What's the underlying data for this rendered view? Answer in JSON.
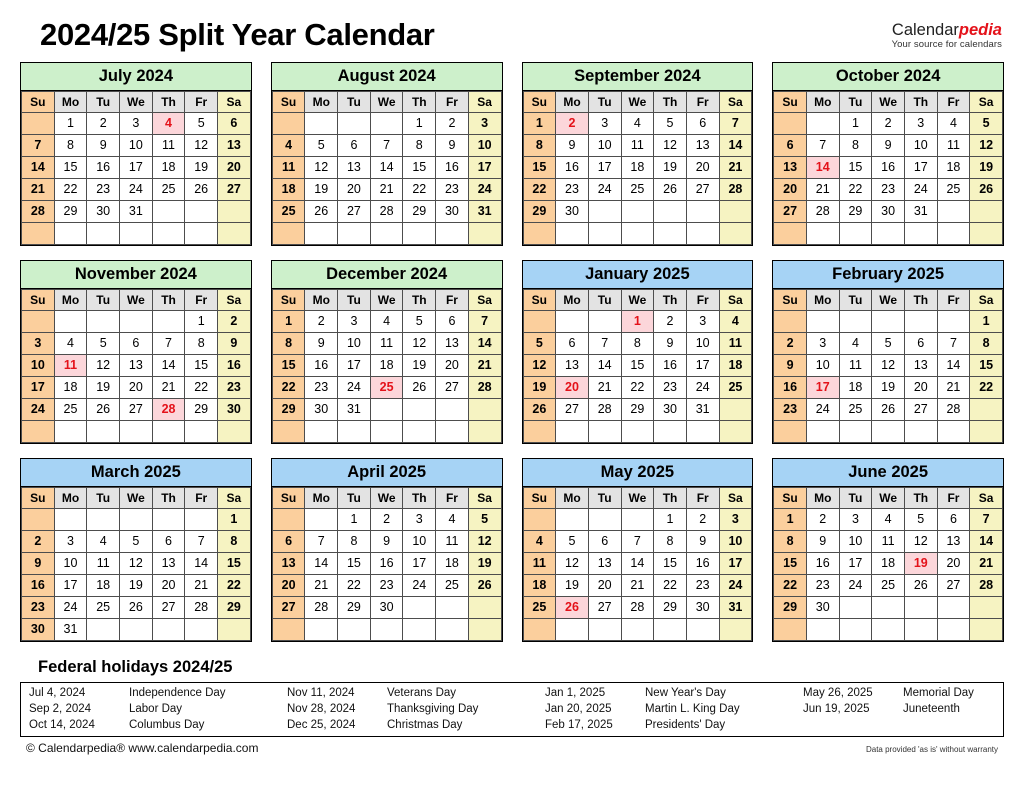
{
  "header": {
    "title": "2024/25 Split Year Calendar",
    "brand_name_part1": "Calendar",
    "brand_name_part2": "pedia",
    "brand_tagline": "Your source for calendars"
  },
  "colors": {
    "header_2024": "#cdf0cb",
    "header_2025": "#a6d3f5",
    "sunday": "#fbcf9d",
    "saturday": "#f6f3c2",
    "weekday_header": "#e3e3e3",
    "holiday_bg": "#fcd6da",
    "holiday_text": "#e4121a"
  },
  "weekday_labels": [
    "Su",
    "Mo",
    "Tu",
    "We",
    "Th",
    "Fr",
    "Sa"
  ],
  "months": [
    {
      "title": "July 2024",
      "year_group": "2024",
      "weeks": [
        [
          "",
          "1",
          "2",
          "3",
          "4",
          "5",
          "6"
        ],
        [
          "7",
          "8",
          "9",
          "10",
          "11",
          "12",
          "13"
        ],
        [
          "14",
          "15",
          "16",
          "17",
          "18",
          "19",
          "20"
        ],
        [
          "21",
          "22",
          "23",
          "24",
          "25",
          "26",
          "27"
        ],
        [
          "28",
          "29",
          "30",
          "31",
          "",
          "",
          ""
        ],
        [
          "",
          "",
          "",
          "",
          "",
          "",
          ""
        ]
      ],
      "holidays": [
        "4"
      ]
    },
    {
      "title": "August 2024",
      "year_group": "2024",
      "weeks": [
        [
          "",
          "",
          "",
          "",
          "1",
          "2",
          "3"
        ],
        [
          "4",
          "5",
          "6",
          "7",
          "8",
          "9",
          "10"
        ],
        [
          "11",
          "12",
          "13",
          "14",
          "15",
          "16",
          "17"
        ],
        [
          "18",
          "19",
          "20",
          "21",
          "22",
          "23",
          "24"
        ],
        [
          "25",
          "26",
          "27",
          "28",
          "29",
          "30",
          "31"
        ],
        [
          "",
          "",
          "",
          "",
          "",
          "",
          ""
        ]
      ],
      "holidays": []
    },
    {
      "title": "September 2024",
      "year_group": "2024",
      "weeks": [
        [
          "1",
          "2",
          "3",
          "4",
          "5",
          "6",
          "7"
        ],
        [
          "8",
          "9",
          "10",
          "11",
          "12",
          "13",
          "14"
        ],
        [
          "15",
          "16",
          "17",
          "18",
          "19",
          "20",
          "21"
        ],
        [
          "22",
          "23",
          "24",
          "25",
          "26",
          "27",
          "28"
        ],
        [
          "29",
          "30",
          "",
          "",
          "",
          "",
          ""
        ],
        [
          "",
          "",
          "",
          "",
          "",
          "",
          ""
        ]
      ],
      "holidays": [
        "2"
      ]
    },
    {
      "title": "October 2024",
      "year_group": "2024",
      "weeks": [
        [
          "",
          "",
          "1",
          "2",
          "3",
          "4",
          "5"
        ],
        [
          "6",
          "7",
          "8",
          "9",
          "10",
          "11",
          "12"
        ],
        [
          "13",
          "14",
          "15",
          "16",
          "17",
          "18",
          "19"
        ],
        [
          "20",
          "21",
          "22",
          "23",
          "24",
          "25",
          "26"
        ],
        [
          "27",
          "28",
          "29",
          "30",
          "31",
          "",
          ""
        ],
        [
          "",
          "",
          "",
          "",
          "",
          "",
          ""
        ]
      ],
      "holidays": [
        "14"
      ]
    },
    {
      "title": "November 2024",
      "year_group": "2024",
      "weeks": [
        [
          "",
          "",
          "",
          "",
          "",
          "1",
          "2"
        ],
        [
          "3",
          "4",
          "5",
          "6",
          "7",
          "8",
          "9"
        ],
        [
          "10",
          "11",
          "12",
          "13",
          "14",
          "15",
          "16"
        ],
        [
          "17",
          "18",
          "19",
          "20",
          "21",
          "22",
          "23"
        ],
        [
          "24",
          "25",
          "26",
          "27",
          "28",
          "29",
          "30"
        ],
        [
          "",
          "",
          "",
          "",
          "",
          "",
          ""
        ]
      ],
      "holidays": [
        "11",
        "28"
      ]
    },
    {
      "title": "December 2024",
      "year_group": "2024",
      "weeks": [
        [
          "1",
          "2",
          "3",
          "4",
          "5",
          "6",
          "7"
        ],
        [
          "8",
          "9",
          "10",
          "11",
          "12",
          "13",
          "14"
        ],
        [
          "15",
          "16",
          "17",
          "18",
          "19",
          "20",
          "21"
        ],
        [
          "22",
          "23",
          "24",
          "25",
          "26",
          "27",
          "28"
        ],
        [
          "29",
          "30",
          "31",
          "",
          "",
          "",
          ""
        ],
        [
          "",
          "",
          "",
          "",
          "",
          "",
          ""
        ]
      ],
      "holidays": [
        "25"
      ]
    },
    {
      "title": "January 2025",
      "year_group": "2025",
      "weeks": [
        [
          "",
          "",
          "",
          "1",
          "2",
          "3",
          "4"
        ],
        [
          "5",
          "6",
          "7",
          "8",
          "9",
          "10",
          "11"
        ],
        [
          "12",
          "13",
          "14",
          "15",
          "16",
          "17",
          "18"
        ],
        [
          "19",
          "20",
          "21",
          "22",
          "23",
          "24",
          "25"
        ],
        [
          "26",
          "27",
          "28",
          "29",
          "30",
          "31",
          ""
        ],
        [
          "",
          "",
          "",
          "",
          "",
          "",
          ""
        ]
      ],
      "holidays": [
        "1",
        "20"
      ]
    },
    {
      "title": "February 2025",
      "year_group": "2025",
      "weeks": [
        [
          "",
          "",
          "",
          "",
          "",
          "",
          "1"
        ],
        [
          "2",
          "3",
          "4",
          "5",
          "6",
          "7",
          "8"
        ],
        [
          "9",
          "10",
          "11",
          "12",
          "13",
          "14",
          "15"
        ],
        [
          "16",
          "17",
          "18",
          "19",
          "20",
          "21",
          "22"
        ],
        [
          "23",
          "24",
          "25",
          "26",
          "27",
          "28",
          ""
        ],
        [
          "",
          "",
          "",
          "",
          "",
          "",
          ""
        ]
      ],
      "holidays": [
        "17"
      ]
    },
    {
      "title": "March 2025",
      "year_group": "2025",
      "weeks": [
        [
          "",
          "",
          "",
          "",
          "",
          "",
          "1"
        ],
        [
          "2",
          "3",
          "4",
          "5",
          "6",
          "7",
          "8"
        ],
        [
          "9",
          "10",
          "11",
          "12",
          "13",
          "14",
          "15"
        ],
        [
          "16",
          "17",
          "18",
          "19",
          "20",
          "21",
          "22"
        ],
        [
          "23",
          "24",
          "25",
          "26",
          "27",
          "28",
          "29"
        ],
        [
          "30",
          "31",
          "",
          "",
          "",
          "",
          ""
        ]
      ],
      "holidays": []
    },
    {
      "title": "April 2025",
      "year_group": "2025",
      "weeks": [
        [
          "",
          "",
          "1",
          "2",
          "3",
          "4",
          "5"
        ],
        [
          "6",
          "7",
          "8",
          "9",
          "10",
          "11",
          "12"
        ],
        [
          "13",
          "14",
          "15",
          "16",
          "17",
          "18",
          "19"
        ],
        [
          "20",
          "21",
          "22",
          "23",
          "24",
          "25",
          "26"
        ],
        [
          "27",
          "28",
          "29",
          "30",
          "",
          "",
          ""
        ],
        [
          "",
          "",
          "",
          "",
          "",
          "",
          ""
        ]
      ],
      "holidays": []
    },
    {
      "title": "May 2025",
      "year_group": "2025",
      "weeks": [
        [
          "",
          "",
          "",
          "",
          "1",
          "2",
          "3"
        ],
        [
          "4",
          "5",
          "6",
          "7",
          "8",
          "9",
          "10"
        ],
        [
          "11",
          "12",
          "13",
          "14",
          "15",
          "16",
          "17"
        ],
        [
          "18",
          "19",
          "20",
          "21",
          "22",
          "23",
          "24"
        ],
        [
          "25",
          "26",
          "27",
          "28",
          "29",
          "30",
          "31"
        ],
        [
          "",
          "",
          "",
          "",
          "",
          "",
          ""
        ]
      ],
      "holidays": [
        "26"
      ]
    },
    {
      "title": "June 2025",
      "year_group": "2025",
      "weeks": [
        [
          "1",
          "2",
          "3",
          "4",
          "5",
          "6",
          "7"
        ],
        [
          "8",
          "9",
          "10",
          "11",
          "12",
          "13",
          "14"
        ],
        [
          "15",
          "16",
          "17",
          "18",
          "19",
          "20",
          "21"
        ],
        [
          "22",
          "23",
          "24",
          "25",
          "26",
          "27",
          "28"
        ],
        [
          "29",
          "30",
          "",
          "",
          "",
          "",
          ""
        ],
        [
          "",
          "",
          "",
          "",
          "",
          "",
          ""
        ]
      ],
      "holidays": [
        "19"
      ]
    }
  ],
  "footer": {
    "holidays_title": "Federal holidays 2024/25",
    "holiday_rows": [
      [
        {
          "date": "Jul 4, 2024",
          "name": "Independence Day"
        },
        {
          "date": "Nov 11, 2024",
          "name": "Veterans Day"
        },
        {
          "date": "Jan 1, 2025",
          "name": "New Year's Day"
        },
        {
          "date": "May 26, 2025",
          "name": "Memorial Day"
        }
      ],
      [
        {
          "date": "Sep 2, 2024",
          "name": "Labor Day"
        },
        {
          "date": "Nov 28, 2024",
          "name": "Thanksgiving Day"
        },
        {
          "date": "Jan 20, 2025",
          "name": "Martin L. King Day"
        },
        {
          "date": "Jun 19, 2025",
          "name": "Juneteenth"
        }
      ],
      [
        {
          "date": "Oct 14, 2024",
          "name": "Columbus Day"
        },
        {
          "date": "Dec 25, 2024",
          "name": "Christmas Day"
        },
        {
          "date": "Feb 17, 2025",
          "name": "Presidents' Day"
        },
        {
          "date": "",
          "name": ""
        }
      ]
    ],
    "copyright": "© Calendarpedia®   www.calendarpedia.com",
    "disclaimer": "Data provided 'as is' without warranty"
  }
}
